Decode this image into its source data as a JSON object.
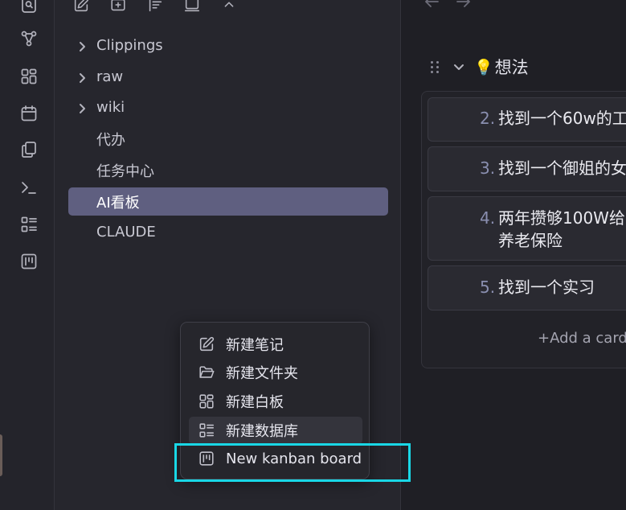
{
  "ribbon": {
    "icons": [
      "search-icon",
      "graph-icon",
      "grid-icon",
      "calendar-icon",
      "copy-icon",
      "terminal-icon",
      "list-icon",
      "kanban-icon"
    ]
  },
  "sidebar": {
    "toolbar_icons": [
      "new-note-icon",
      "new-folder-icon",
      "sort-icon",
      "collapse-icon",
      "chevron-up-icon"
    ],
    "tree": [
      {
        "label": "Clippings",
        "type": "folder"
      },
      {
        "label": "raw",
        "type": "folder"
      },
      {
        "label": "wiki",
        "type": "folder"
      },
      {
        "label": "代办",
        "type": "file"
      },
      {
        "label": "任务中心",
        "type": "file"
      },
      {
        "label": "AI看板",
        "type": "file",
        "active": true
      },
      {
        "label": "CLAUDE",
        "type": "file"
      }
    ]
  },
  "kanban": {
    "lane_title": "想法",
    "lane_emoji": "💡",
    "cards": [
      {
        "num": "2.",
        "lines": [
          "找到一个60w的工"
        ]
      },
      {
        "num": "3.",
        "lines": [
          "找到一个御姐的女"
        ]
      },
      {
        "num": "4.",
        "lines": [
          "两年攒够100W给",
          "养老保险"
        ]
      },
      {
        "num": "5.",
        "lines": [
          "找到一个实习"
        ]
      }
    ],
    "add_card": "+Add a card"
  },
  "context_menu": {
    "items": [
      {
        "label": "新建笔记",
        "icon": "edit-icon"
      },
      {
        "label": "新建文件夹",
        "icon": "folder-open-icon"
      },
      {
        "label": "新建白板",
        "icon": "grid-icon"
      },
      {
        "label": "新建数据库",
        "icon": "list-icon"
      },
      {
        "label": "New kanban board",
        "icon": "kanban-icon"
      }
    ]
  },
  "colors": {
    "accent_active": "#5f5f80",
    "highlight": "#19d7e6"
  }
}
